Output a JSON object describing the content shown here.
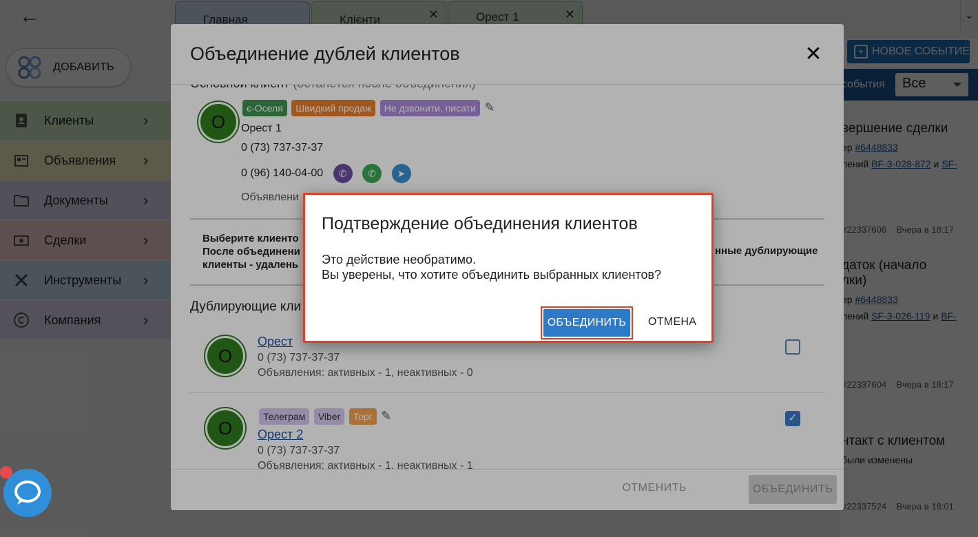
{
  "tabs": {
    "main": "Главная",
    "clients": "Клієнти",
    "orest": "Орест 1"
  },
  "sidebar": {
    "add_label": "ДОБАВИТЬ",
    "items": [
      {
        "label": "Клиенты",
        "icon": "contacts-icon"
      },
      {
        "label": "Объявления",
        "icon": "listing-icon"
      },
      {
        "label": "Документы",
        "icon": "folder-icon"
      },
      {
        "label": "Сделки",
        "icon": "cash-icon"
      },
      {
        "label": "Инструменты",
        "icon": "tools-icon"
      },
      {
        "label": "Компания",
        "icon": "copyright-icon"
      }
    ]
  },
  "events": {
    "new_event_label": "НОВОЕ СОБЫТИЕ",
    "filter_label": "события",
    "filter_value": "Все",
    "items": [
      {
        "title": "вершение сделки",
        "line1_prefix": "ер ",
        "line1_link": "#6448833",
        "line2_prefix": "лений ",
        "line2_link": "BF-3-028-872",
        "line2_mid": " и ",
        "line2_link2": "SF-",
        "meta_id": "#22337606",
        "meta_time": "Вчера в 18:17"
      },
      {
        "title": "даток (начало",
        "title2": "лки)",
        "line1_prefix": "ер ",
        "line1_link": "#6448833",
        "line2_prefix": "лений ",
        "line2_link": "SF-3-026-119",
        "line2_mid": " и ",
        "line2_link2": "BF-",
        "meta_id": "#22337604",
        "meta_time": "Вчера в 18:17"
      },
      {
        "title": "нтакт с клиентом",
        "line1": "были изменены",
        "meta_id": "#22337524",
        "meta_time": "Вчера в 18:01"
      }
    ]
  },
  "merge_dialog": {
    "title": "Объединение дублей клиентов",
    "main_client_label": "Основной клиент",
    "main_client_hint": "(останется после объединения)",
    "main_client": {
      "avatar": "О",
      "tags": [
        "є-Оселя",
        "Швидкий продаж",
        "Не дзвонити, писати"
      ],
      "name": "Орест 1",
      "phone1": "0 (73) 737-37-37",
      "phone2": "0 (96) 140-04-00",
      "ads_text": "Объявлени"
    },
    "instruction_left_1": "Выберите клиенто",
    "instruction_left_2": "После объединени",
    "instruction_left_3": "клиенты - удалень",
    "instruction_right": "нные дублирующие",
    "duplicates_label": "Дублирующие кли",
    "duplicates": [
      {
        "avatar": "О",
        "name": "Орест",
        "phone": "0 (73) 737-37-37",
        "ads": "Объявления: активных - 1, неактивных - 0",
        "checked": false
      },
      {
        "avatar": "О",
        "tags": [
          "Телеграм",
          "Viber",
          "Торг"
        ],
        "name": "Орест 2",
        "phone": "0 (73) 737-37-37",
        "ads": "Объявления: активных - 1, неактивных - 1",
        "checked": true
      }
    ],
    "cancel_label": "ОТМЕНИТЬ",
    "merge_label": "ОБЪЕДИНИТЬ"
  },
  "confirm_dialog": {
    "title": "Подтверждение объединения клиентов",
    "message_1": "Это действие необратимо.",
    "message_2": "Вы уверены, что хотите объединить выбранных клиентов?",
    "confirm_label": "ОБЪЕДИНИТЬ",
    "cancel_label": "ОТМЕНА"
  },
  "colors": {
    "accent_blue": "#2f7ac8",
    "highlight_red": "#e0402b",
    "avatar_green": "#2e7d1f"
  }
}
